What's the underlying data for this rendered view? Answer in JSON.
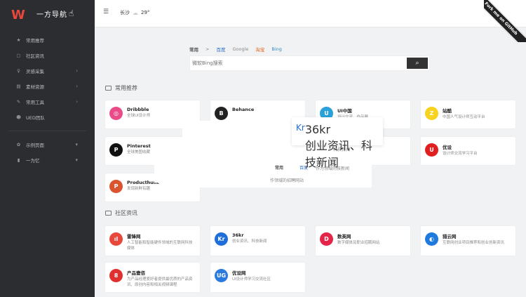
{
  "logo": {
    "text": "一方导航"
  },
  "sidebar": {
    "items": [
      {
        "label": "常用推荐",
        "icon": "star-icon"
      },
      {
        "label": "社区资讯",
        "icon": "chat-icon"
      },
      {
        "label": "灵感采集",
        "icon": "bulb-icon",
        "arrow": true
      },
      {
        "label": "素材资源",
        "icon": "box-icon",
        "arrow": true
      },
      {
        "label": "常用工具",
        "icon": "wrench-icon",
        "arrow": true
      },
      {
        "label": "UED团队",
        "icon": "users-icon"
      }
    ],
    "extra": [
      {
        "label": "示例页面",
        "icon": "gear-icon",
        "arrow": true
      },
      {
        "label": "一为忆",
        "icon": "book-icon",
        "arrow": true
      }
    ]
  },
  "header": {
    "city": "长沙",
    "temp": "29°",
    "ribbon": "Fork me on GitHub"
  },
  "search": {
    "tabs": [
      "常用",
      ">",
      "百度",
      "Google",
      "淘宝",
      "Bing"
    ],
    "placeholder": "微软Bing搜索"
  },
  "sections": {
    "common": "常用推荐",
    "community": "社区资讯"
  },
  "common_cards": [
    {
      "title": "Dribbble",
      "desc": "全球UI设计师",
      "color": "#ea4c89",
      "glyph": "◎"
    },
    {
      "title": "Behance",
      "desc": "",
      "color": "#222",
      "glyph": "B"
    },
    {
      "title": "UI中国",
      "desc": "设计交流，作品展",
      "color": "#2aa1d8",
      "glyph": "U"
    },
    {
      "title": "站酷",
      "desc": "中国人气设计师互动平台",
      "color": "#f7d21e",
      "glyph": "Z"
    },
    {
      "title": "Pinterest",
      "desc": "全球美图收藏",
      "color": "#111",
      "glyph": "P"
    },
    {
      "title": "",
      "desc": "",
      "color": "#fff",
      "glyph": ""
    },
    {
      "title": "",
      "desc": "",
      "color": "#fff",
      "glyph": ""
    },
    {
      "title": "优设",
      "desc": "设计师交流学习平台",
      "color": "#e02020",
      "glyph": "U"
    },
    {
      "title": "Producthunt",
      "desc": "发现新鲜有趣",
      "color": "#da552f",
      "glyph": "P"
    }
  ],
  "community_cards": [
    {
      "title": "雷锋网",
      "desc": "人工智能和智能硬件领域的互联网科技媒体",
      "color": "#e8483b",
      "glyph": "ıl"
    },
    {
      "title": "36kr",
      "desc": "创业资讯、科技新闻",
      "color": "#1e6fd9",
      "glyph": "Kr"
    },
    {
      "title": "数英网",
      "desc": "数字媒体及职业招聘网站",
      "color": "#e4254a",
      "glyph": "D"
    },
    {
      "title": "猎云网",
      "desc": "互联网创业项目推荐和创业创新资讯",
      "color": "#1f7ae0",
      "glyph": "◐"
    },
    {
      "title": "产品壹佰",
      "desc": "为产品经理爱好者提供最优质的产品资讯、原创内容和相关视频课程",
      "color": "#e02f2f",
      "glyph": "8"
    },
    {
      "title": "优设网",
      "desc": "UI设计师学习交流社区",
      "color": "#2a7ae0",
      "glyph": "UG"
    }
  ],
  "floating": {
    "title": "36kr",
    "desc": "创业资讯、科技新闻",
    "glyph": "Kr",
    "color": "#1e6fd9"
  },
  "ghosts": [
    "科技新闻",
    "常用",
    "百度",
    "作为领域的技新闻",
    "作领域的招聘网站"
  ]
}
